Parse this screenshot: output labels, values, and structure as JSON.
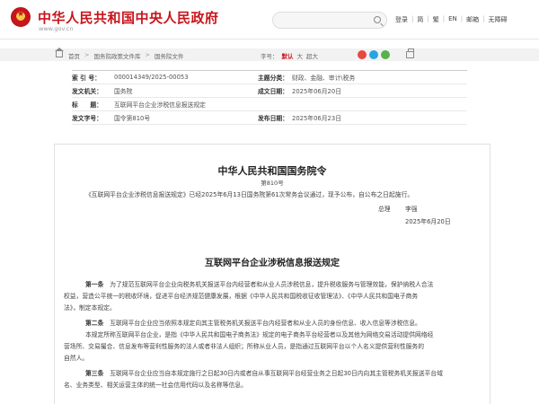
{
  "header": {
    "title": "中华人民共和国中央人民政府",
    "url": "www.gov.cn",
    "links": [
      "登录",
      "简",
      "繁",
      "EN",
      "邮箱",
      "无障碍"
    ]
  },
  "breadcrumb": {
    "items": [
      "首页",
      "国务院政策文件库",
      "国务院文件"
    ],
    "font_label": "字号：",
    "font_sizes": [
      "默认",
      "大",
      "超大"
    ]
  },
  "share_colors": [
    "#e8483d",
    "#2aa3e0",
    "#57b24b"
  ],
  "meta": {
    "index_label": "索 引 号：",
    "index_value": "000014349/2025-00053",
    "category_label": "主题分类：",
    "category_value": "财政、金融、审计\\税务",
    "issuer_label": "发文机关：",
    "issuer_value": "国务院",
    "written_label": "成文日期：",
    "written_value": "2025年06月20日",
    "title_label": "标　　题：",
    "title_value": "互联网平台企业涉税信息报送规定",
    "docno_label": "发文字号：",
    "docno_value": "国令第810号",
    "published_label": "发布日期：",
    "published_value": "2025年06月23日"
  },
  "article": {
    "org": "中华人民共和国国务院令",
    "order_no": "第810号",
    "order_text": "《互联网平台企业涉税信息报送规定》已经2025年6月13日国务院第61次常务会议通过，现予公布，自公布之日起施行。",
    "sign_title": "总理",
    "sign_name": "李强",
    "sign_date": "2025年6月20日",
    "reg_title": "互联网平台企业涉税信息报送规定",
    "paras": [
      {
        "head": "第一条",
        "lines": [
          "为了规范互联网平台企业向税务机关报送平台内经营者和从业人员涉税信息，提升税收服务与管理效能，保护纳税人合法",
          "权益，营造公平统一的税收环境，促进平台经济规范健康发展，根据《中华人民共和国税收征收管理法》、《中华人民共和国电子商务",
          "法》，制定本规定。"
        ]
      },
      {
        "head": "第二条",
        "lines": [
          "互联网平台企业应当依照本规定向其主管税务机关报送平台内经营者和从业人员的身份信息、收入信息等涉税信息。"
        ]
      },
      {
        "head": "",
        "lines": [
          "本规定所称互联网平台企业，是指《中华人民共和国电子商务法》规定的电子商务平台经营者以及其他为网络交易活动提供网络经",
          "营场所、交易撮合、信息发布等营利性服务的法人或者非法人组织；所称从业人员，是指通过互联网平台以个人名义提供营利性服务的",
          "自然人。"
        ]
      },
      {
        "head": "第三条",
        "lines": [
          "互联网平台企业应当自本规定施行之日起30日内或者自从事互联网平台经营业务之日起30日内向其主管税务机关报送平台域",
          "名、业务类型、相关运营主体的统一社会信用代码以及名称等信息。"
        ]
      }
    ]
  }
}
